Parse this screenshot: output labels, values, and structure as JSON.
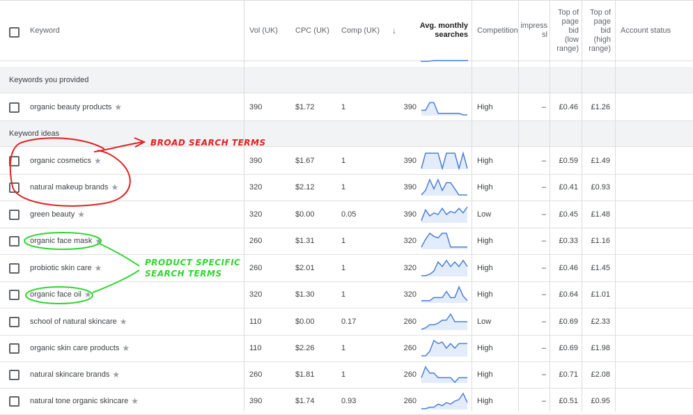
{
  "header": {
    "keyword": "Keyword",
    "vol": "Vol (UK)",
    "cpc": "CPC (UK)",
    "comp": "Comp (UK)",
    "sort_arrow": "↓",
    "avg1": "Avg. monthly",
    "avg2": "searches",
    "competition": "Competition",
    "impr1": "impress",
    "impr2": "sl",
    "low1": "Top of",
    "low2": "page",
    "low3": "bid",
    "low4": "(low",
    "low5": "range)",
    "high1": "Top of",
    "high2": "page",
    "high3": "bid",
    "high4": "(high",
    "high5": "range)",
    "account": "Account status"
  },
  "sections": {
    "provided": "Keywords you provided",
    "ideas": "Keyword ideas"
  },
  "rows": [
    {
      "keyword": "organic beauty products",
      "vol": "390",
      "cpc": "$1.72",
      "comp": "1",
      "avg": "390",
      "competition": "High",
      "impr": "–",
      "low": "£0.46",
      "high": "£1.26",
      "spark": [
        0.3,
        0.3,
        0.8,
        0.8,
        0.1,
        0.1,
        0.1,
        0.1,
        0.1,
        0.1,
        0.0,
        0.0
      ]
    },
    {
      "keyword": "organic cosmetics",
      "vol": "390",
      "cpc": "$1.67",
      "comp": "1",
      "avg": "390",
      "competition": "High",
      "impr": "–",
      "low": "£0.59",
      "high": "£1.49",
      "spark": [
        0.0,
        1.0,
        1.0,
        1.0,
        1.0,
        0.0,
        1.0,
        1.0,
        1.0,
        0.0,
        1.0,
        0.0
      ]
    },
    {
      "keyword": "natural makeup brands",
      "vol": "320",
      "cpc": "$2.12",
      "comp": "1",
      "avg": "390",
      "competition": "High",
      "impr": "–",
      "low": "£0.41",
      "high": "£0.93",
      "spark": [
        0.0,
        0.3,
        1.0,
        0.4,
        1.0,
        0.3,
        0.8,
        0.8,
        0.4,
        0.0,
        0.0,
        0.0
      ]
    },
    {
      "keyword": "green beauty",
      "vol": "320",
      "cpc": "$0.00",
      "comp": "0.05",
      "avg": "390",
      "competition": "Low",
      "impr": "–",
      "low": "£0.45",
      "high": "£1.48",
      "spark": [
        0.1,
        0.8,
        0.4,
        0.6,
        0.5,
        0.9,
        0.5,
        0.7,
        0.6,
        0.9,
        0.6,
        1.0
      ]
    },
    {
      "keyword": "organic face mask",
      "vol": "260",
      "cpc": "$1.31",
      "comp": "1",
      "avg": "320",
      "competition": "High",
      "impr": "–",
      "low": "£0.33",
      "high": "£1.16",
      "spark": [
        0.1,
        0.6,
        1.0,
        0.8,
        0.7,
        1.0,
        1.0,
        0.1,
        0.1,
        0.1,
        0.1,
        0.1
      ]
    },
    {
      "keyword": "probiotic skin care",
      "vol": "260",
      "cpc": "$2.01",
      "comp": "1",
      "avg": "320",
      "competition": "High",
      "impr": "–",
      "low": "£0.46",
      "high": "£1.45",
      "spark": [
        0.0,
        0.0,
        0.1,
        0.3,
        0.9,
        0.6,
        1.0,
        0.6,
        0.9,
        0.6,
        1.0,
        0.6
      ]
    },
    {
      "keyword": "organic face oil",
      "vol": "320",
      "cpc": "$1.30",
      "comp": "1",
      "avg": "320",
      "competition": "High",
      "impr": "–",
      "low": "£0.64",
      "high": "£1.01",
      "spark": [
        0.1,
        0.1,
        0.1,
        0.3,
        0.3,
        0.3,
        0.7,
        0.3,
        0.3,
        1.0,
        0.4,
        0.1
      ]
    },
    {
      "keyword": "school of natural skincare",
      "vol": "110",
      "cpc": "$0.00",
      "comp": "0.17",
      "avg": "260",
      "competition": "Low",
      "impr": "–",
      "low": "£0.69",
      "high": "£2.33",
      "spark": [
        0.0,
        0.1,
        0.3,
        0.3,
        0.4,
        0.6,
        0.6,
        1.0,
        0.5,
        0.5,
        0.5,
        0.5
      ]
    },
    {
      "keyword": "organic skin care products",
      "vol": "110",
      "cpc": "$2.26",
      "comp": "1",
      "avg": "260",
      "competition": "High",
      "impr": "–",
      "low": "£0.69",
      "high": "£1.98",
      "spark": [
        0.0,
        0.0,
        0.3,
        1.0,
        0.8,
        0.9,
        0.5,
        0.8,
        0.5,
        0.8,
        0.8,
        0.8
      ]
    },
    {
      "keyword": "natural skincare brands",
      "vol": "260",
      "cpc": "$1.81",
      "comp": "1",
      "avg": "260",
      "competition": "High",
      "impr": "–",
      "low": "£0.71",
      "high": "£2.08",
      "spark": [
        0.3,
        1.0,
        0.6,
        0.6,
        0.3,
        0.3,
        0.3,
        0.3,
        0.0,
        0.3,
        0.3,
        0.3
      ]
    },
    {
      "keyword": "natural tone organic skincare",
      "vol": "390",
      "cpc": "$1.74",
      "comp": "0.93",
      "avg": "260",
      "competition": "High",
      "impr": "–",
      "low": "£0.51",
      "high": "£0.95",
      "spark": [
        0.0,
        0.0,
        0.1,
        0.1,
        0.3,
        0.2,
        0.4,
        0.3,
        0.5,
        0.6,
        1.0,
        0.4
      ]
    }
  ],
  "annotations": {
    "broad": "BROAD SEARCH TERMS",
    "product1": "PRODUCT SPECIFIC",
    "product2": "SEARCH TERMS"
  },
  "colors": {
    "spark_line": "#4a7fd6",
    "spark_fill": "#e3ecfa",
    "red_annot": "#e02020",
    "green_annot": "#2fd62f"
  }
}
